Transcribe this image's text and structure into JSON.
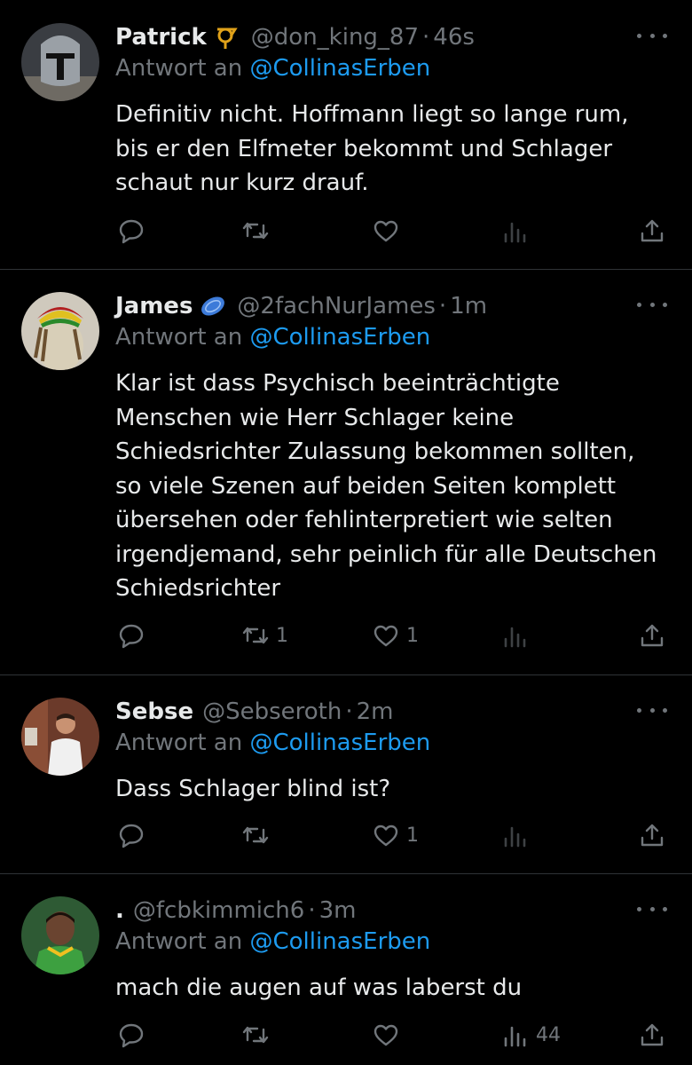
{
  "reply_prefix": "Antwort an",
  "tweets": [
    {
      "name": "Patrick",
      "badge": "post-horn-icon",
      "handle": "@don_king_87",
      "time": "46s",
      "reply_to": "@CollinasErben",
      "text": "Definitiv nicht. Hoffmann liegt so lange rum, bis er den Elfmeter bekommt und Schlager schaut nur kurz drauf.",
      "counts": {
        "reply": "",
        "retweet": "",
        "like": "",
        "views": ""
      }
    },
    {
      "name": "James",
      "badge": "frisbee-icon",
      "handle": "@2fachNurJames",
      "time": "1m",
      "reply_to": "@CollinasErben",
      "text": "Klar ist dass Psychisch beeinträchtigte Menschen wie Herr Schlager keine Schiedsrichter Zulassung bekommen sollten, so viele Szenen auf beiden Seiten komplett übersehen oder fehlinterpretiert wie selten irgendjemand, sehr peinlich für alle Deutschen Schiedsrichter",
      "counts": {
        "reply": "",
        "retweet": "1",
        "like": "1",
        "views": ""
      }
    },
    {
      "name": "Sebse",
      "badge": "",
      "handle": "@Sebseroth",
      "time": "2m",
      "reply_to": "@CollinasErben",
      "text": "Dass Schlager blind ist?",
      "counts": {
        "reply": "",
        "retweet": "",
        "like": "1",
        "views": ""
      }
    },
    {
      "name": ".",
      "badge": "",
      "handle": "@fcbkimmich6",
      "time": "3m",
      "reply_to": "@CollinasErben",
      "text": "mach die augen auf was laberst du",
      "counts": {
        "reply": "",
        "retweet": "",
        "like": "",
        "views": "44"
      }
    }
  ],
  "colors": {
    "background": "#000000",
    "text": "#e7e9ea",
    "muted": "#71767b",
    "link": "#1d9bf0",
    "divider": "#2f3336"
  }
}
